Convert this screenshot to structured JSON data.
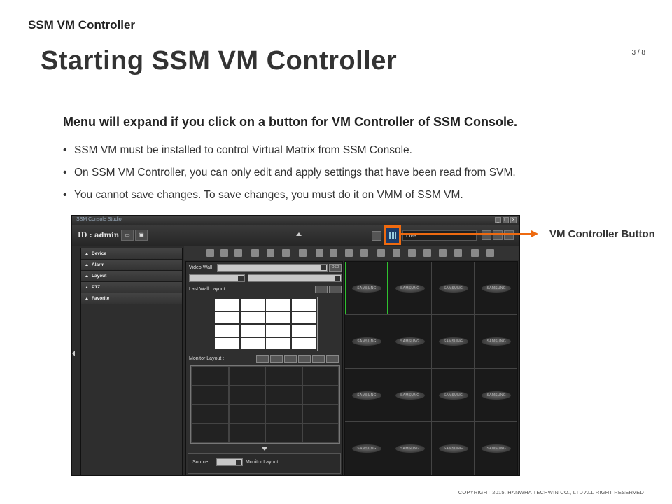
{
  "header": {
    "section": "SSM VM Controller",
    "page": "3 / 8"
  },
  "title": "Starting SSM VM Controller",
  "lead": "Menu will expand if you click on a button for VM Controller of SSM Console.",
  "bullets": [
    "SSM VM must be installed to control Virtual Matrix from SSM Console.",
    "On SSM VM Controller, you can only edit and apply settings that have been read from SVM.",
    "You cannot save changes. To save changes, you must do it on VMM of SSM VM."
  ],
  "screenshot": {
    "app_title": "SSM Console Studio",
    "user": "ID : admin",
    "live": "Live",
    "sidebar": [
      "Device",
      "Alarm",
      "Layout",
      "PTZ",
      "Favorite"
    ],
    "video_wall_label": "Video Wall",
    "osd": "OSD",
    "last_wall_layout": "Last Wall Layout :",
    "monitor_layout": "Monitor Layout :",
    "source": "Source :",
    "monitor_layout_2": "Monitor Layout :",
    "logo_text": "SAMSUNG"
  },
  "callout": {
    "label": "VM Controller Button",
    "color": "#ee6a10"
  },
  "footer": {
    "copyright": "COPYRIGHT 2015. HANWHA TECHWIN CO., LTD ALL RIGHT RESERVED"
  }
}
